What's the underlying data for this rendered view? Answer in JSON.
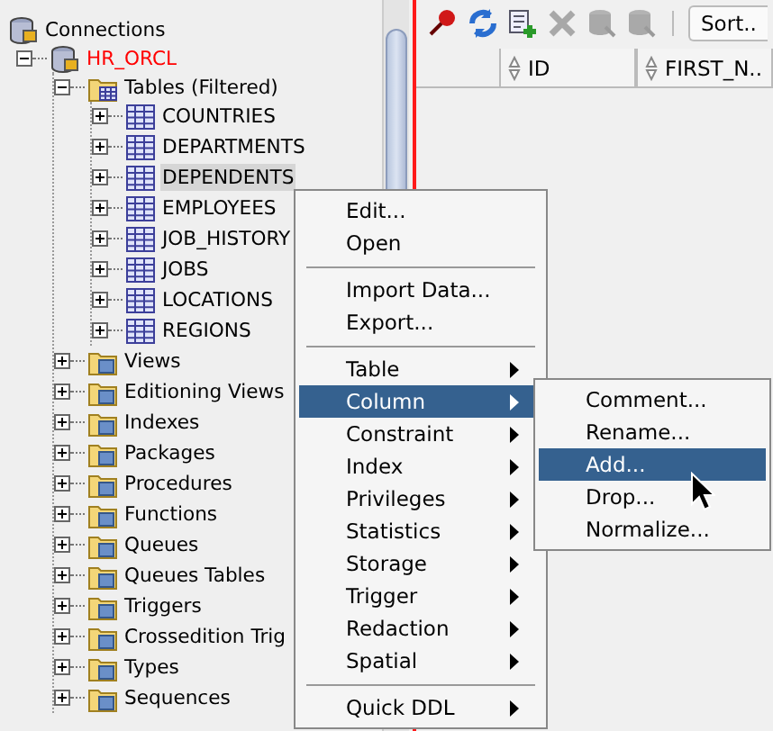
{
  "tree": {
    "label": "Connections",
    "kind": "connections",
    "children": [
      {
        "label": "HR_ORCL",
        "kind": "connection",
        "expanded": true,
        "selected": false,
        "children": [
          {
            "label": "Tables (Filtered)",
            "kind": "tables",
            "expanded": true,
            "selected": false,
            "children": [
              {
                "label": "COUNTRIES",
                "kind": "table",
                "expanded": false,
                "selected": false
              },
              {
                "label": "DEPARTMENTS",
                "kind": "table",
                "expanded": false,
                "selected": false
              },
              {
                "label": "DEPENDENTS",
                "kind": "table",
                "expanded": false,
                "selected": true
              },
              {
                "label": "EMPLOYEES",
                "kind": "table",
                "expanded": false,
                "selected": false
              },
              {
                "label": "JOB_HISTORY",
                "kind": "table",
                "expanded": false,
                "selected": false
              },
              {
                "label": "JOBS",
                "kind": "table",
                "expanded": false,
                "selected": false
              },
              {
                "label": "LOCATIONS",
                "kind": "table",
                "expanded": false,
                "selected": false
              },
              {
                "label": "REGIONS",
                "kind": "table",
                "expanded": false,
                "selected": false
              }
            ]
          },
          {
            "label": "Views",
            "kind": "folder",
            "expanded": false,
            "selected": false
          },
          {
            "label": "Editioning Views",
            "kind": "folder",
            "expanded": false,
            "selected": false
          },
          {
            "label": "Indexes",
            "kind": "folder",
            "expanded": false,
            "selected": false
          },
          {
            "label": "Packages",
            "kind": "folder",
            "expanded": false,
            "selected": false
          },
          {
            "label": "Procedures",
            "kind": "folder",
            "expanded": false,
            "selected": false
          },
          {
            "label": "Functions",
            "kind": "folder",
            "expanded": false,
            "selected": false
          },
          {
            "label": "Queues",
            "kind": "folder",
            "expanded": false,
            "selected": false
          },
          {
            "label": "Queues Tables",
            "kind": "folder",
            "expanded": false,
            "selected": false
          },
          {
            "label": "Triggers",
            "kind": "folder",
            "expanded": false,
            "selected": false
          },
          {
            "label": "Crossedition Trig",
            "kind": "folder",
            "expanded": false,
            "selected": false
          },
          {
            "label": "Types",
            "kind": "folder",
            "expanded": false,
            "selected": false
          },
          {
            "label": "Sequences",
            "kind": "folder",
            "expanded": false,
            "selected": false
          }
        ]
      }
    ]
  },
  "toolbar": [
    {
      "kind": "pin",
      "disabled": false
    },
    {
      "kind": "refresh",
      "disabled": false
    },
    {
      "kind": "add",
      "disabled": false
    },
    {
      "kind": "delete",
      "disabled": true
    },
    {
      "kind": "db",
      "disabled": true
    },
    {
      "kind": "db",
      "disabled": true
    }
  ],
  "sort_button": "Sort..",
  "grid": {
    "columns": [
      "ID",
      "FIRST_N.."
    ]
  },
  "context_menu": {
    "groups": [
      [
        {
          "label": "Edit...",
          "has_submenu": false,
          "selected": false
        },
        {
          "label": "Open",
          "has_submenu": false,
          "selected": false
        }
      ],
      [
        {
          "label": "Import Data...",
          "has_submenu": false,
          "selected": false
        },
        {
          "label": "Export...",
          "has_submenu": false,
          "selected": false
        }
      ],
      [
        {
          "label": "Table",
          "has_submenu": true,
          "selected": false
        },
        {
          "label": "Column",
          "has_submenu": true,
          "selected": true
        },
        {
          "label": "Constraint",
          "has_submenu": true,
          "selected": false
        },
        {
          "label": "Index",
          "has_submenu": true,
          "selected": false
        },
        {
          "label": "Privileges",
          "has_submenu": true,
          "selected": false
        },
        {
          "label": "Statistics",
          "has_submenu": true,
          "selected": false
        },
        {
          "label": "Storage",
          "has_submenu": true,
          "selected": false
        },
        {
          "label": "Trigger",
          "has_submenu": true,
          "selected": false
        },
        {
          "label": "Redaction",
          "has_submenu": true,
          "selected": false
        },
        {
          "label": "Spatial",
          "has_submenu": true,
          "selected": false
        }
      ],
      [
        {
          "label": "Quick DDL",
          "has_submenu": true,
          "selected": false
        }
      ]
    ]
  },
  "submenu": {
    "items": [
      {
        "label": "Comment...",
        "selected": false
      },
      {
        "label": "Rename...",
        "selected": false
      },
      {
        "label": "Add...",
        "selected": true
      },
      {
        "label": "Drop...",
        "selected": false
      },
      {
        "label": "Normalize...",
        "selected": false
      }
    ]
  }
}
